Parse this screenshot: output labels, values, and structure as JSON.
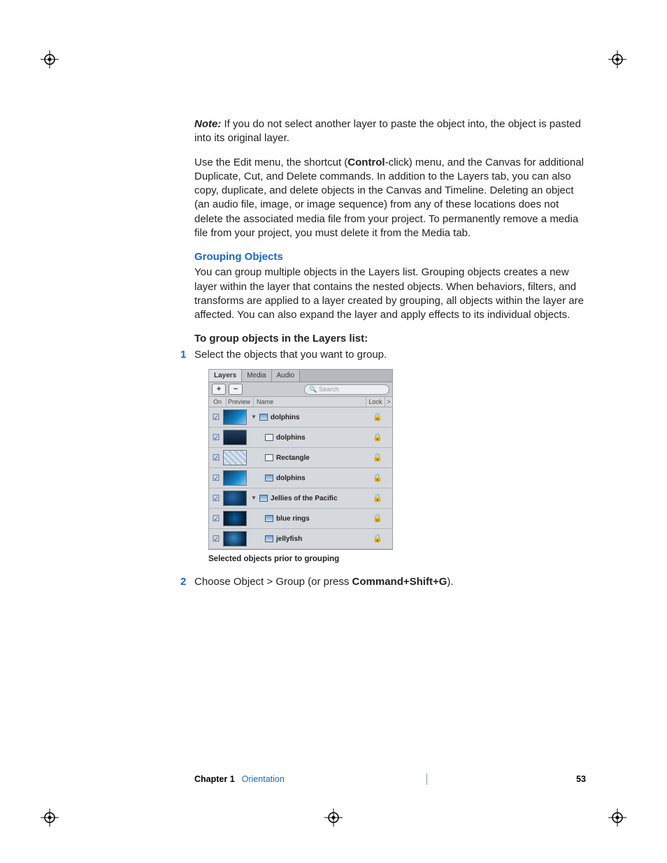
{
  "note": {
    "label": "Note:",
    "text": "If you do not select another layer to paste the object into, the object is pasted into its original layer."
  },
  "para_edit": {
    "pre": "Use the Edit menu, the shortcut (",
    "bold": "Control",
    "post": "-click) menu, and the Canvas for additional Duplicate, Cut, and Delete commands. In addition to the Layers tab, you can also copy, duplicate, and delete objects in the Canvas and Timeline. Deleting an object (an audio file, image, or image sequence) from any of these locations does not delete the associated media file from your project. To permanently remove a media file from your project, you must delete it from the Media tab."
  },
  "section_head": "Grouping Objects",
  "section_body": "You can group multiple objects in the Layers list. Grouping objects creates a new layer within the layer that contains the nested objects. When behaviors, filters, and transforms are applied to a layer created by grouping, all objects within the layer are affected. You can also expand the layer and apply effects to its individual objects.",
  "procedure_title": "To group objects in the Layers list:",
  "steps": {
    "s1": {
      "n": "1",
      "t": "Select the objects that you want to group."
    },
    "s2": {
      "n": "2",
      "pre": "Choose Object > Group (or press ",
      "bold": "Command+Shift+G",
      "post": ")."
    }
  },
  "panel": {
    "tabs": {
      "layers": "Layers",
      "media": "Media",
      "audio": "Audio"
    },
    "add": "+",
    "remove": "−",
    "search_placeholder": "Search",
    "cols": {
      "on": "On",
      "preview": "Preview",
      "name": "Name",
      "lock": "Lock",
      "arrow": ">"
    },
    "rows": {
      "r0": "dolphins",
      "r1": "dolphins",
      "r2": "Rectangle",
      "r3": "dolphins",
      "r4": "Jellies of the Pacific",
      "r5": "blue rings",
      "r6": "jellyfish"
    },
    "check": "☑",
    "lock": "🔒",
    "tri_down": "▼"
  },
  "caption": "Selected objects prior to grouping",
  "footer": {
    "chapter_label": "Chapter 1",
    "chapter_title": "Orientation",
    "page": "53"
  }
}
